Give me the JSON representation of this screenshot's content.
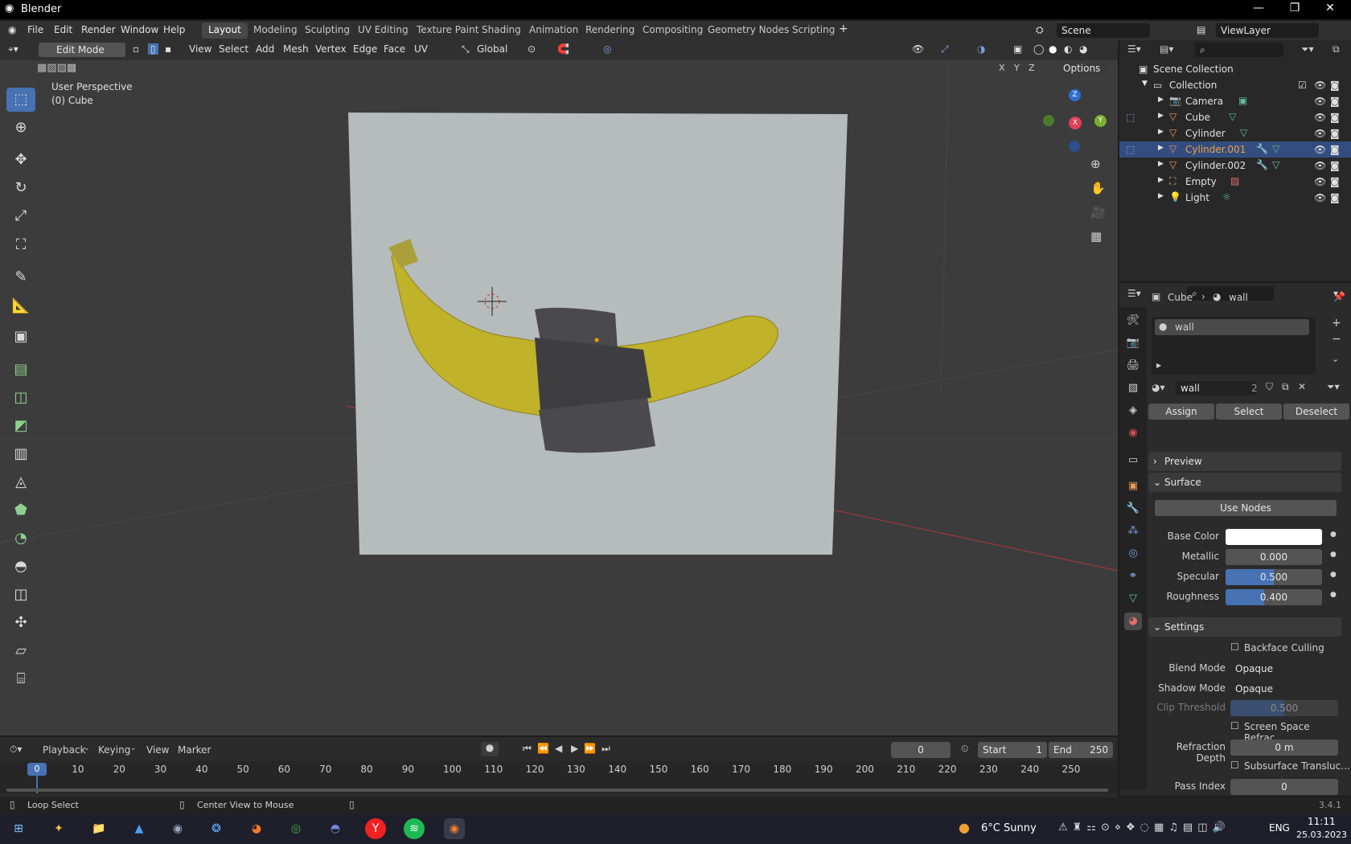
{
  "titlebar": {
    "title": "Blender",
    "minimize": "—",
    "maximize": "❐",
    "close": "✕"
  },
  "menu": {
    "file": "File",
    "edit": "Edit",
    "render": "Render",
    "window": "Window",
    "help": "Help"
  },
  "workspaces": [
    "Layout",
    "Modeling",
    "Sculpting",
    "UV Editing",
    "Texture Paint",
    "Shading",
    "Animation",
    "Rendering",
    "Compositing",
    "Geometry Nodes",
    "Scripting"
  ],
  "active_workspace": "Layout",
  "scene_field": "Scene",
  "viewlayer_field": "ViewLayer",
  "header": {
    "mode": "Edit Mode",
    "view": "View",
    "select": "Select",
    "add": "Add",
    "mesh": "Mesh",
    "vertex": "Vertex",
    "edge": "Edge",
    "face": "Face",
    "uv": "UV",
    "transform": "Global",
    "options": "Options",
    "axis_x": "X",
    "axis_y": "Y",
    "axis_z": "Z"
  },
  "viewport": {
    "perspective": "User Perspective",
    "object": "(0) Cube",
    "gizmo_x": "X",
    "gizmo_y": "Y",
    "gizmo_z": "Z"
  },
  "outliner": {
    "scene_collection": "Scene Collection",
    "collection": "Collection",
    "items": [
      "Camera",
      "Cube",
      "Cylinder",
      "Cylinder.001",
      "Cylinder.002",
      "Empty",
      "Light"
    ]
  },
  "properties": {
    "breadcrumb_object": "Cube",
    "breadcrumb_material": "wall",
    "slot_name": "wall",
    "material_field": "wall",
    "user_count": "2",
    "assign": "Assign",
    "select": "Select",
    "deselect": "Deselect",
    "preview": "Preview",
    "surface": "Surface",
    "use_nodes": "Use Nodes",
    "base_color_label": "Base Color",
    "metallic_label": "Metallic",
    "metallic_value": "0.000",
    "specular_label": "Specular",
    "specular_value": "0.500",
    "roughness_label": "Roughness",
    "roughness_value": "0.400",
    "settings": "Settings",
    "backface": "Backface Culling",
    "blend_label": "Blend Mode",
    "blend_value": "Opaque",
    "shadow_label": "Shadow Mode",
    "shadow_value": "Opaque",
    "clip_label": "Clip Threshold",
    "clip_value": "0.500",
    "ssr": "Screen Space Refrac...",
    "refraction_label": "Refraction Depth",
    "refraction_value": "0 m",
    "sss": "Subsurface Transluc...",
    "pass_label": "Pass Index",
    "pass_value": "0"
  },
  "timeline": {
    "playback": "Playback",
    "keying": "Keying",
    "view": "View",
    "marker": "Marker",
    "current_frame": "0",
    "start_label": "Start",
    "start": "1",
    "end_label": "End",
    "end": "250",
    "ticks": [
      "0",
      "10",
      "20",
      "30",
      "40",
      "50",
      "60",
      "70",
      "80",
      "90",
      "100",
      "110",
      "120",
      "130",
      "140",
      "150",
      "160",
      "170",
      "180",
      "190",
      "200",
      "210",
      "220",
      "230",
      "240",
      "250"
    ]
  },
  "status": {
    "left": "Loop Select",
    "middle": "Center View to Mouse",
    "version": "3.4.1"
  },
  "taskbar": {
    "weather": "6°C  Sunny",
    "lang": "ENG",
    "time": "11:11",
    "date": "25.03.2023"
  },
  "colors": {
    "accent": "#4772b3",
    "selected_text": "#f0a040",
    "banana": "#c9b92a",
    "tape": "#3e3e40",
    "wall": "#b6bbbb"
  }
}
